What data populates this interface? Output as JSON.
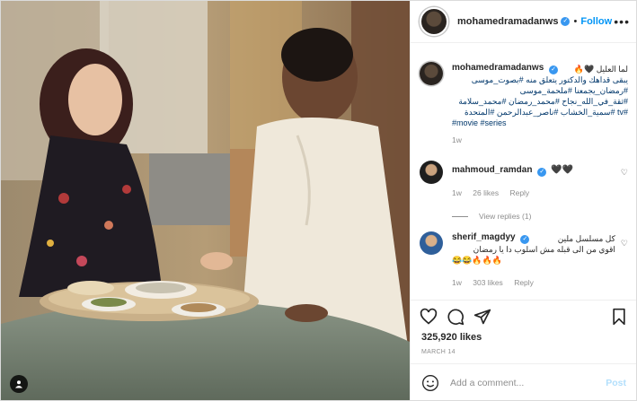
{
  "post": {
    "author": "mohamedramadanws",
    "follow_label": "Follow",
    "separator": "•",
    "more_label": "•••",
    "caption_lines": [
      "لما العليل 🖤🔥",
      "يبقى قداهك والدكتور يتعلق منه #بصوت_موسى",
      "#رمضان_يجمعنا #ملحمة_موسى",
      "#ثقة_في_الله_نجاح #محمد_رمضان #محمد_سلامة",
      "#tv #سمية_الخشاب #ناصر_عبدالرحمن #المتحدة",
      "#movie #series"
    ],
    "caption_time": "1w",
    "likes": "325,920 likes",
    "date": "MARCH 14",
    "comment_placeholder": "Add a comment...",
    "post_label": "Post"
  },
  "comments": [
    {
      "user": "mahmoud_ramdan",
      "text": "🖤🖤",
      "time": "1w",
      "likes": "26 likes",
      "reply_label": "Reply",
      "view_replies": "View replies (1)"
    },
    {
      "user": "sherif_magdyy",
      "text_lines": [
        "كل مسلسل ملين",
        "اقوي من الى قبله مش اسلوب دا يا رمضان",
        "😂😂🔥🔥🔥"
      ],
      "time": "1w",
      "likes": "303 likes",
      "reply_label": "Reply"
    }
  ],
  "icons": [
    "verified-icon",
    "more-icon",
    "heart-icon",
    "comment-icon",
    "share-icon",
    "save-icon",
    "emoji-icon",
    "user-tag-icon"
  ],
  "colors": {
    "link": "#0095f6",
    "hashtag": "#00376b",
    "muted": "#8e8e8e",
    "verified": "#3897f0"
  }
}
